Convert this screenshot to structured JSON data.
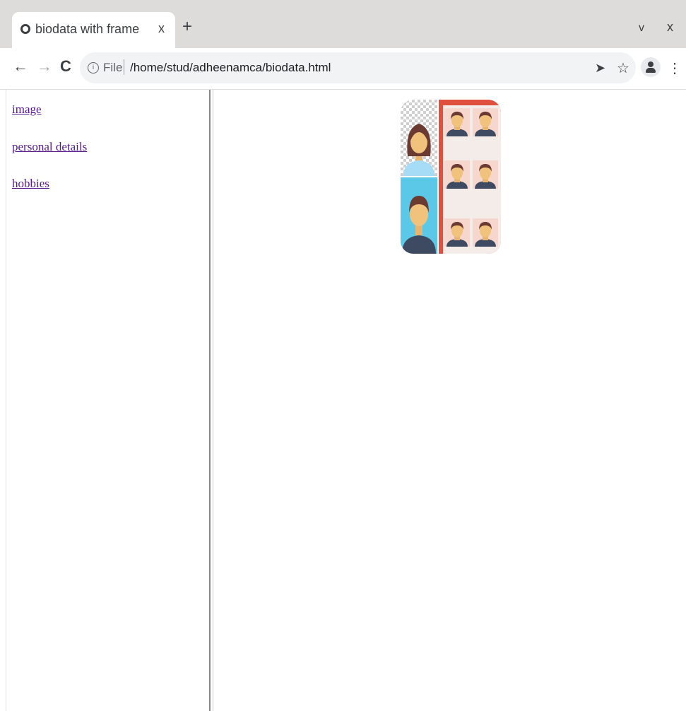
{
  "browser": {
    "tab_title": "biodata with frame",
    "tab_close": "x",
    "new_tab": "+",
    "window_minimize": "v",
    "window_close": "x",
    "file_label": "File",
    "url": "/home/stud/adheenamca/biodata.html"
  },
  "left_frame": {
    "links": [
      "image",
      "personal details",
      "hobbies"
    ]
  },
  "right_frame": {
    "image_icon": "passport-photos-icon"
  },
  "colors": {
    "link_visited": "#551a8b",
    "photo_red": "#e0503e",
    "photo_blue": "#5bc8e8",
    "photo_pink": "#f7d6ce"
  }
}
